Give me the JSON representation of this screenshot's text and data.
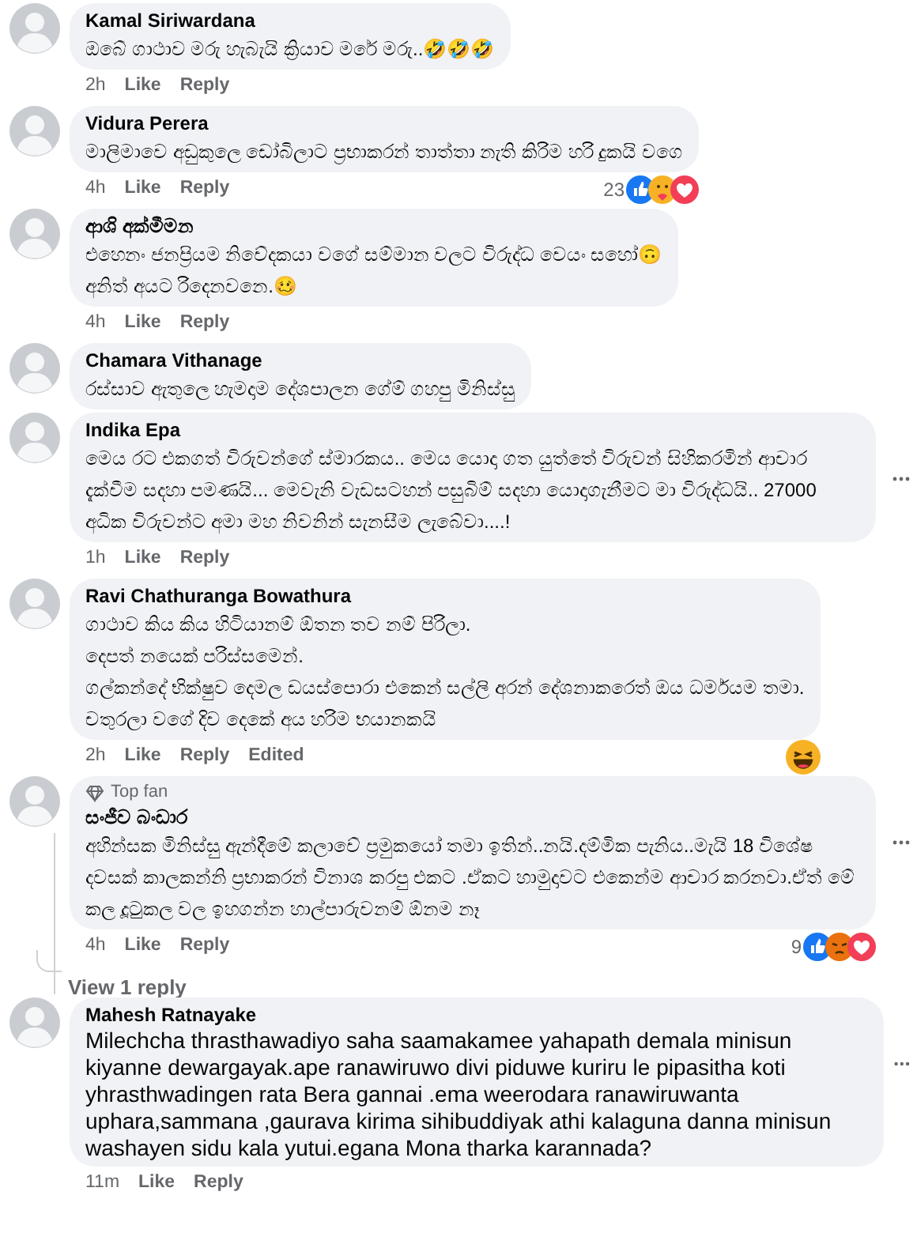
{
  "comments": [
    {
      "author": "Kamal Siriwardana",
      "top_fan": false,
      "lines": [
        "ඔබේ ගාථාව මරු හැබැයි ක්‍රියාව මරේ මරු..🤣🤣🤣"
      ],
      "time": "2h",
      "actions": [
        "Like",
        "Reply"
      ],
      "more_button": false
    },
    {
      "author": "Vidura Perera",
      "top_fan": false,
      "lines": [
        "මාලිමාවෙ අඩුකුලෙ ඩෝබිලාට ප්‍රභාකරන් තාත්තා නැති කිරිම හරි දුකයි වගෙ"
      ],
      "time": "4h",
      "actions": [
        "Like",
        "Reply"
      ],
      "reactions": {
        "count": "23",
        "icons": [
          {
            "kind": "like"
          },
          {
            "kind": "care"
          },
          {
            "kind": "love"
          }
        ]
      },
      "more_button": false
    },
    {
      "author": "ආශි අක්මීමන",
      "top_fan": false,
      "lines": [
        "එහෙනං ජනප්‍රියම නිවේදකයා වගේ සම්මාන වලට විරුද්ධ වෙයං සහෝ🙃",
        "අනිත් අයට රිදෙනවනෙ.🥴"
      ],
      "time": "4h",
      "actions": [
        "Like",
        "Reply"
      ],
      "more_button": false
    },
    {
      "author": "Chamara Vithanage",
      "top_fan": false,
      "lines": [
        "රස්සාව ඇතුලෙ හැමදාම දේශපාලන ගේම් ගහපු මිනිස්සු"
      ],
      "more_button": false
    },
    {
      "author": "Indika Epa",
      "top_fan": false,
      "lines": [
        "මෙය රට එකගත් විරුවන්ගේ ස්මාරකය.. මෙය යොදා ගත යුත්තේ විරුවන් සිහිකරමින් ආචාර දැක්වීම සදහා පමණයි... මෙවැනි වැඩසටහන් පසුබිම් සදහා යොදාගැනීමට මා විරුද්ධයි.. 27000 අධික විරුවන්ට අමා මහ නිවනින් සැනසීම ලැබේවා....!"
      ],
      "time": "1h",
      "actions": [
        "Like",
        "Reply"
      ],
      "more_button": true
    },
    {
      "author": "Ravi Chathuranga Bowathura",
      "top_fan": false,
      "lines": [
        "ගාථාව කිය කිය හිටියානම් ඕතන තව නම් පිරිලා.",
        "දෙපත් නයෙක් පරිස්සමෙන්.",
        "ගල්කන්දේ භික්ෂුව දෙමල ඩයස්පොරා එකෙන් සල්ලි අරන් දේශනාකරෙත් ඔය ධර්මයම තමා.",
        "චතුරලා වගේ දිව දෙකේ අය හරිම භයානකයි"
      ],
      "time": "2h",
      "actions": [
        "Like",
        "Reply"
      ],
      "edited": "Edited",
      "reactions": {
        "icons": [
          {
            "kind": "haha"
          }
        ]
      },
      "more_button": false
    },
    {
      "author": "සංජීව බංඩාර",
      "top_fan": true,
      "top_fan_label": "Top fan",
      "lines": [
        "අහින්සක මිනිස්සු ඇන්දීමේ කලාවේ ප්‍රමුකයෝ තමා ඉතින්..නයි.දම්මික පැනිය..මැයි 18 විශේෂ දවසක් කාලකන්නි ප්‍රභාකරන් විනාශ කරපු එකට .ඒකට හාමුදාවට එකෙන්ම ආචාර කරනවා.ඒත් මේ කල දූටුකල වල ඉහගන්න හාල්පාරුවනම් ඕනම නෑ"
      ],
      "time": "4h",
      "actions": [
        "Like",
        "Reply"
      ],
      "reactions": {
        "count": "9",
        "icons": [
          {
            "kind": "like"
          },
          {
            "kind": "angry"
          },
          {
            "kind": "love"
          }
        ]
      },
      "view_replies": "View 1 reply",
      "more_button": true
    },
    {
      "author": "Mahesh Ratnayake",
      "top_fan": false,
      "kind": "latin",
      "lines": [
        "Milechcha thrasthawadiyo saha saamakamee yahapath demala minisun kiyanne dewargayak.ape ranawiruwo divi piduwe kuriru le pipasitha koti yhrasthwadingen rata Bera gannai .ema weerodara ranawiruwanta uphara,sammana ,gaurava kirima sihibuddiyak athi kalaguna danna minisun washayen sidu kala yutui.egana Mona tharka karannada?"
      ],
      "time": "11m",
      "actions": [
        "Like",
        "Reply"
      ],
      "more_button": true
    }
  ]
}
